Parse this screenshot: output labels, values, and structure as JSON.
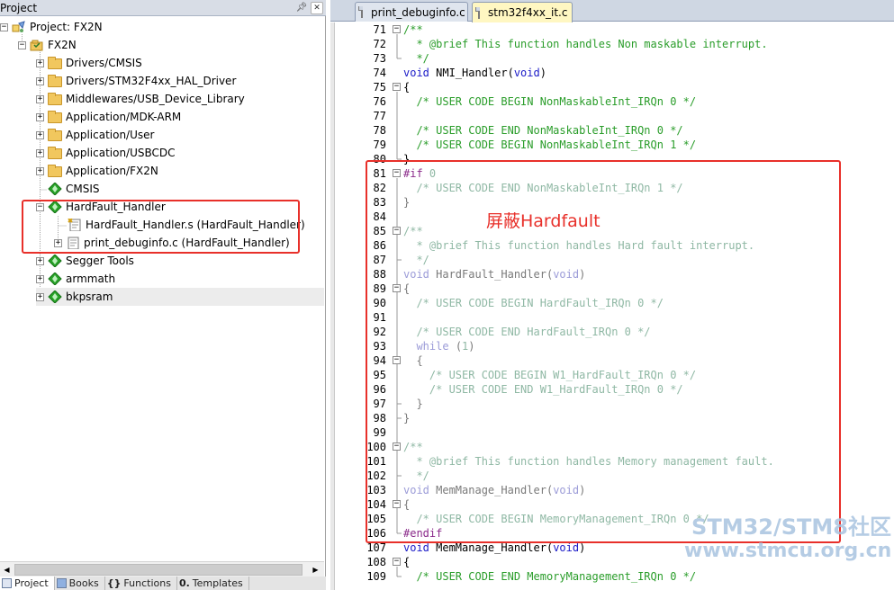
{
  "project_panel": {
    "title": "Project",
    "pin_icon": "pin-icon",
    "close_icon": "close-icon",
    "tree": [
      {
        "label": "Project: FX2N",
        "icon": "project-icon",
        "expanded": true
      },
      {
        "label": "FX2N",
        "icon": "target-icon",
        "expanded": true
      },
      {
        "label": "Drivers/CMSIS",
        "icon": "folder-icon",
        "expanded": false
      },
      {
        "label": "Drivers/STM32F4xx_HAL_Driver",
        "icon": "folder-icon",
        "expanded": false
      },
      {
        "label": "Middlewares/USB_Device_Library",
        "icon": "folder-icon",
        "expanded": false
      },
      {
        "label": "Application/MDK-ARM",
        "icon": "folder-icon",
        "expanded": false
      },
      {
        "label": "Application/User",
        "icon": "folder-icon",
        "expanded": false
      },
      {
        "label": "Application/USBCDC",
        "icon": "folder-icon",
        "expanded": false
      },
      {
        "label": "Application/FX2N",
        "icon": "folder-icon",
        "expanded": false
      },
      {
        "label": "CMSIS",
        "icon": "component-icon"
      },
      {
        "label": "HardFault_Handler",
        "icon": "component-icon",
        "expanded": true
      },
      {
        "label": "HardFault_Handler.s (HardFault_Handler)",
        "icon": "asm-file-icon"
      },
      {
        "label": "print_debuginfo.c (HardFault_Handler)",
        "icon": "c-file-icon",
        "expanded": false
      },
      {
        "label": "Segger Tools",
        "icon": "component-icon",
        "expanded": false
      },
      {
        "label": "armmath",
        "icon": "component-icon",
        "expanded": false
      },
      {
        "label": "bkpsram",
        "icon": "component-icon",
        "expanded": false
      }
    ],
    "bottom_tabs": [
      {
        "label": "Project",
        "icon": "project-tab-icon"
      },
      {
        "label": "Books",
        "icon": "books-icon"
      },
      {
        "label": "Functions",
        "icon": "functions-icon"
      },
      {
        "label": "Templates",
        "icon": "templates-icon"
      }
    ]
  },
  "editor": {
    "tabs": [
      {
        "label": "print_debuginfo.c",
        "active": false
      },
      {
        "label": "stm32f4xx_it.c",
        "active": true
      }
    ],
    "lines": [
      {
        "n": "71",
        "fold": "-",
        "text": "/**",
        "style": "comment"
      },
      {
        "n": "72",
        "fold": "",
        "text": "  * @brief This function handles Non maskable interrupt.",
        "style": "comment"
      },
      {
        "n": "73",
        "fold": "",
        "text": "  */",
        "style": "comment"
      },
      {
        "n": "74",
        "fold": "",
        "text": "void NMI_Handler(void)",
        "style": "func"
      },
      {
        "n": "75",
        "fold": "-",
        "text": "{",
        "style": "plain"
      },
      {
        "n": "76",
        "fold": "",
        "text": "  /* USER CODE BEGIN NonMaskableInt_IRQn 0 */",
        "style": "comment"
      },
      {
        "n": "77",
        "fold": "",
        "text": "",
        "style": "plain"
      },
      {
        "n": "78",
        "fold": "",
        "text": "  /* USER CODE END NonMaskableInt_IRQn 0 */",
        "style": "comment"
      },
      {
        "n": "79",
        "fold": "",
        "text": "  /* USER CODE BEGIN NonMaskableInt_IRQn 1 */",
        "style": "comment"
      },
      {
        "n": "80",
        "fold": "",
        "text": "}",
        "style": "plain"
      },
      {
        "n": "81",
        "fold": "-",
        "text": "#if 0",
        "style": "pre"
      },
      {
        "n": "82",
        "fold": "",
        "text": "  /* USER CODE END NonMaskableInt_IRQn 1 */",
        "style": "dis-comment"
      },
      {
        "n": "83",
        "fold": "",
        "text": "}",
        "style": "dis-plain"
      },
      {
        "n": "84",
        "fold": "",
        "text": "",
        "style": "plain"
      },
      {
        "n": "85",
        "fold": "-",
        "text": "/**",
        "style": "dis-comment"
      },
      {
        "n": "86",
        "fold": "",
        "text": "  * @brief This function handles Hard fault interrupt.",
        "style": "dis-comment"
      },
      {
        "n": "87",
        "fold": "",
        "text": "  */",
        "style": "dis-comment"
      },
      {
        "n": "88",
        "fold": "",
        "text": "void HardFault_Handler(void)",
        "style": "dis-func"
      },
      {
        "n": "89",
        "fold": "-",
        "text": "{",
        "style": "dis-plain"
      },
      {
        "n": "90",
        "fold": "",
        "text": "  /* USER CODE BEGIN HardFault_IRQn 0 */",
        "style": "dis-comment"
      },
      {
        "n": "91",
        "fold": "",
        "text": "",
        "style": "plain"
      },
      {
        "n": "92",
        "fold": "",
        "text": "  /* USER CODE END HardFault_IRQn 0 */",
        "style": "dis-comment"
      },
      {
        "n": "93",
        "fold": "",
        "text": "  while (1)",
        "style": "dis-while"
      },
      {
        "n": "94",
        "fold": "-",
        "text": "  {",
        "style": "dis-plain"
      },
      {
        "n": "95",
        "fold": "",
        "text": "    /* USER CODE BEGIN W1_HardFault_IRQn 0 */",
        "style": "dis-comment"
      },
      {
        "n": "96",
        "fold": "",
        "text": "    /* USER CODE END W1_HardFault_IRQn 0 */",
        "style": "dis-comment"
      },
      {
        "n": "97",
        "fold": "",
        "text": "  }",
        "style": "dis-plain"
      },
      {
        "n": "98",
        "fold": "",
        "text": "}",
        "style": "dis-plain"
      },
      {
        "n": "99",
        "fold": "",
        "text": "",
        "style": "plain"
      },
      {
        "n": "100",
        "fold": "-",
        "text": "/**",
        "style": "dis-comment"
      },
      {
        "n": "101",
        "fold": "",
        "text": "  * @brief This function handles Memory management fault.",
        "style": "dis-comment"
      },
      {
        "n": "102",
        "fold": "",
        "text": "  */",
        "style": "dis-comment"
      },
      {
        "n": "103",
        "fold": "",
        "text": "void MemManage_Handler(void)",
        "style": "dis-func"
      },
      {
        "n": "104",
        "fold": "-",
        "text": "{",
        "style": "dis-plain"
      },
      {
        "n": "105",
        "fold": "",
        "text": "  /* USER CODE BEGIN MemoryManagement_IRQn 0 */",
        "style": "dis-comment"
      },
      {
        "n": "106",
        "fold": "",
        "text": "#endif",
        "style": "pre"
      },
      {
        "n": "107",
        "fold": "",
        "text": "void MemManage_Handler(void)",
        "style": "func"
      },
      {
        "n": "108",
        "fold": "-",
        "text": "{",
        "style": "plain"
      },
      {
        "n": "109",
        "fold": "",
        "text": "  /* USER CODE END MemoryManagement_IRQn 0 */",
        "style": "comment"
      }
    ],
    "annotation": "屏蔽Hardfault"
  },
  "watermark": {
    "title": "STM32/STM8社区",
    "url": "www.stmcu.org.cn"
  },
  "colors": {
    "highlight": "#e8302a",
    "comment": "#2a9d2a",
    "keyword": "#1c1cc8",
    "disabled_code": "#8fb8a4",
    "active_tab": "#fff7c2"
  }
}
